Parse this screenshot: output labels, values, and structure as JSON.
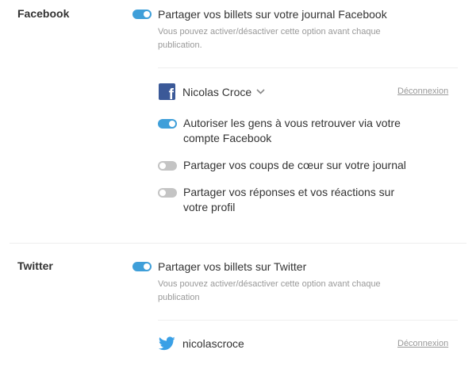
{
  "facebook": {
    "section_title": "Facebook",
    "share_label": "Partager vos billets sur votre journal Facebook",
    "share_desc_line1": "Vous pouvez activer/désactiver cette option avant chaque",
    "share_desc_line2": "publication.",
    "share_on": true,
    "account_name": "Nicolas Croce",
    "disconnect_label": "Déconnexion",
    "options": [
      {
        "line1": "Autoriser les gens à vous retrouver via votre",
        "line2": "compte Facebook",
        "on": true
      },
      {
        "line1": "Partager vos coups de cœur sur votre journal",
        "line2": "",
        "on": false
      },
      {
        "line1": "Partager vos réponses et vos réactions sur",
        "line2": "votre profil",
        "on": false
      }
    ]
  },
  "twitter": {
    "section_title": "Twitter",
    "share_label": "Partager vos billets sur Twitter",
    "share_desc_line1": "Vous pouvez activer/désactiver cette option avant chaque",
    "share_desc_line2": "publication",
    "share_on": true,
    "account_name": "nicolascroce",
    "disconnect_label": "Déconnexion"
  },
  "colors": {
    "toggle_on": "#3f9fd9",
    "toggle_off": "#c4c4c4",
    "facebook_brand": "#3b5998",
    "twitter_brand": "#3aa0e6"
  },
  "icons": {
    "facebook": "facebook-icon",
    "twitter": "twitter-icon",
    "chevron": "chevron-down-icon"
  }
}
